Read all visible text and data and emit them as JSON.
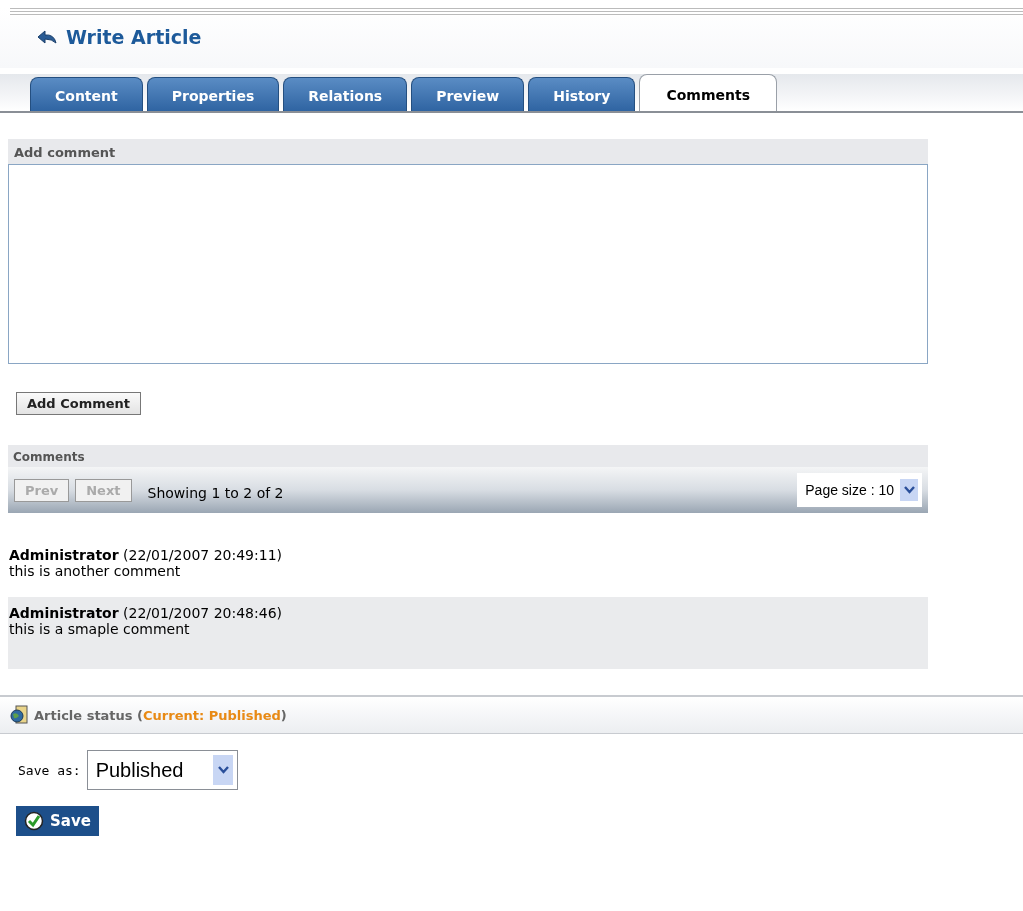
{
  "header": {
    "title": "Write Article"
  },
  "tabs": [
    {
      "label": "Content",
      "selected": false
    },
    {
      "label": "Properties",
      "selected": false
    },
    {
      "label": "Relations",
      "selected": false
    },
    {
      "label": "Preview",
      "selected": false
    },
    {
      "label": "History",
      "selected": false
    },
    {
      "label": "Comments",
      "selected": true
    }
  ],
  "add_comment": {
    "heading": "Add comment",
    "button": "Add Comment"
  },
  "comments": {
    "heading": "Comments",
    "pager": {
      "prev": {
        "label": "Prev",
        "disabled": true
      },
      "next": {
        "label": "Next",
        "disabled": true
      },
      "showing": "Showing 1 to 2 of 2",
      "page_size": "Page size : 10"
    },
    "items": [
      {
        "header": "**Administrator** (22/01/2007 20:49:11)",
        "text": "this is another comment",
        "shaded": false
      },
      {
        "header": "**Administrator** (22/01/2007 20:48:46)",
        "text": "this is a smaple comment",
        "shaded": true
      }
    ]
  },
  "status": {
    "label": "Article status (",
    "current": "Current: Published",
    "suffix": ")",
    "save_as_label": "Save as:",
    "save_as_value": "Published",
    "save_button": "Save"
  }
}
